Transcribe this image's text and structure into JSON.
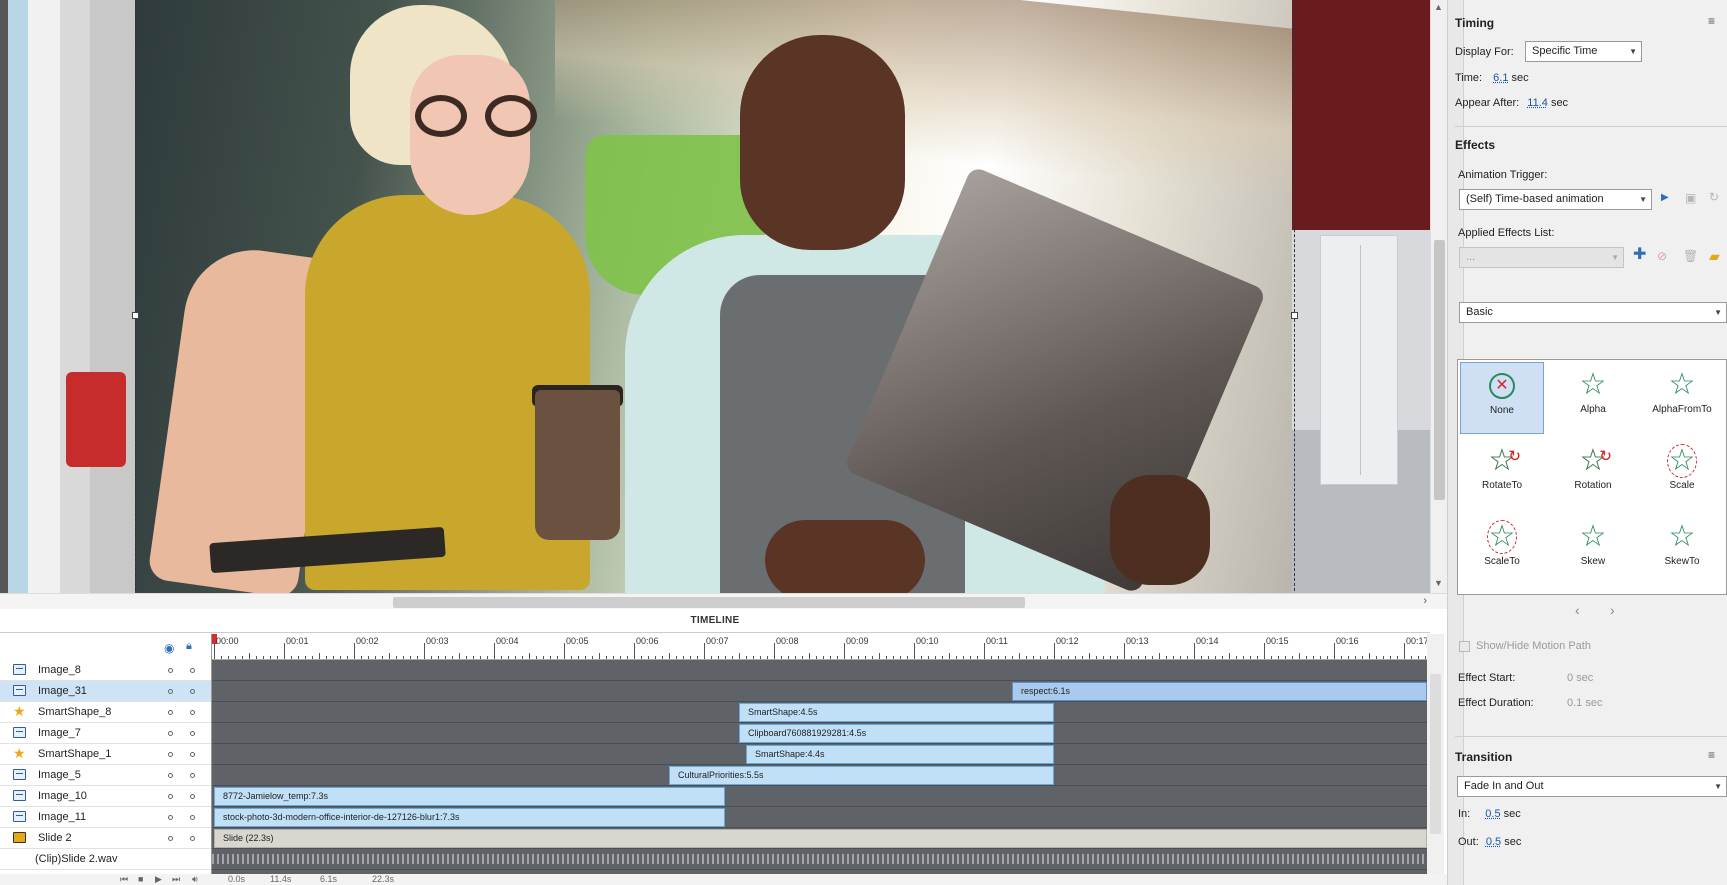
{
  "timing": {
    "title": "Timing",
    "display_for_label": "Display For:",
    "display_for_value": "Specific Time",
    "time_label": "Time:",
    "time_value": "6.1",
    "time_unit": "sec",
    "appear_after_label": "Appear After:",
    "appear_after_value": "11.4",
    "appear_after_unit": "sec"
  },
  "effects": {
    "title": "Effects",
    "trigger_label": "Animation Trigger:",
    "trigger_value": "(Self) Time-based animation",
    "applied_label": "Applied Effects List:",
    "applied_value": "...",
    "category_value": "Basic",
    "items": [
      {
        "label": "None",
        "icon": "none-icon",
        "selected": true
      },
      {
        "label": "Alpha",
        "icon": "star-icon"
      },
      {
        "label": "AlphaFromTo",
        "icon": "star-icon"
      },
      {
        "label": "RotateTo",
        "icon": "rotate-star-icon"
      },
      {
        "label": "Rotation",
        "icon": "rotate-star-icon"
      },
      {
        "label": "Scale",
        "icon": "scale-star-icon"
      },
      {
        "label": "ScaleTo",
        "icon": "scale-star-icon"
      },
      {
        "label": "Skew",
        "icon": "star-icon"
      },
      {
        "label": "SkewTo",
        "icon": "star-icon"
      }
    ],
    "motion_path_label": "Show/Hide Motion Path",
    "effect_start_label": "Effect Start:",
    "effect_start_value": "0",
    "effect_start_unit": "sec",
    "effect_duration_label": "Effect Duration:",
    "effect_duration_value": "0.1",
    "effect_duration_unit": "sec"
  },
  "transition": {
    "title": "Transition",
    "value": "Fade In and Out",
    "in_label": "In:",
    "in_value": "0.5",
    "in_unit": "sec",
    "out_label": "Out:",
    "out_value": "0.5",
    "out_unit": "sec"
  },
  "timeline": {
    "title": "TIMELINE",
    "ticks": [
      "00:00",
      "00:01",
      "00:02",
      "00:03",
      "00:04",
      "00:05",
      "00:06",
      "00:07",
      "00:08",
      "00:09",
      "00:10",
      "00:11",
      "00:12",
      "00:13",
      "00:14",
      "00:15",
      "00:16",
      "00:17"
    ],
    "rows": [
      {
        "name": "Image_8",
        "icon": "image-icon",
        "dots": true
      },
      {
        "name": "Image_31",
        "icon": "image-icon",
        "dots": true,
        "selected": true,
        "bar": {
          "label": "respect:6.1s",
          "start": 11.4,
          "end": 17.5,
          "style": "blue"
        }
      },
      {
        "name": "SmartShape_8",
        "icon": "star-icon",
        "dots": true,
        "bar": {
          "label": "SmartShape:4.5s",
          "start": 7.5,
          "end": 12.0
        }
      },
      {
        "name": "Image_7",
        "icon": "image-icon",
        "dots": true,
        "bar": {
          "label": "Clipboard760881929281:4.5s",
          "start": 7.5,
          "end": 12.0
        }
      },
      {
        "name": "SmartShape_1",
        "icon": "star-icon",
        "dots": true,
        "bar": {
          "label": "SmartShape:4.4s",
          "start": 7.6,
          "end": 12.0
        }
      },
      {
        "name": "Image_5",
        "icon": "image-icon",
        "dots": true,
        "bar": {
          "label": "CulturalPriorities:5.5s",
          "start": 6.5,
          "end": 12.0
        }
      },
      {
        "name": "Image_10",
        "icon": "image-icon",
        "dots": true,
        "bar": {
          "label": "8772-Jamielow_temp:7.3s",
          "start": 0.0,
          "end": 7.3
        }
      },
      {
        "name": "Image_11",
        "icon": "image-icon",
        "dots": true,
        "bar": {
          "label": "stock-photo-3d-modern-office-interior-de-127126-blur1:7.3s",
          "start": 0.0,
          "end": 7.3
        }
      },
      {
        "name": "Slide 2",
        "icon": "slide-icon",
        "dots": true,
        "bar": {
          "label": "Slide (22.3s)",
          "start": 0.0,
          "end": 17.5,
          "style": "slide"
        }
      },
      {
        "name": "(Clip)Slide 2.wav",
        "icon": "none",
        "dots": false,
        "audio": true
      }
    ],
    "footer": {
      "current": "0.0s",
      "start": "11.4s",
      "duration": "6.1s",
      "total": "22.3s"
    }
  }
}
